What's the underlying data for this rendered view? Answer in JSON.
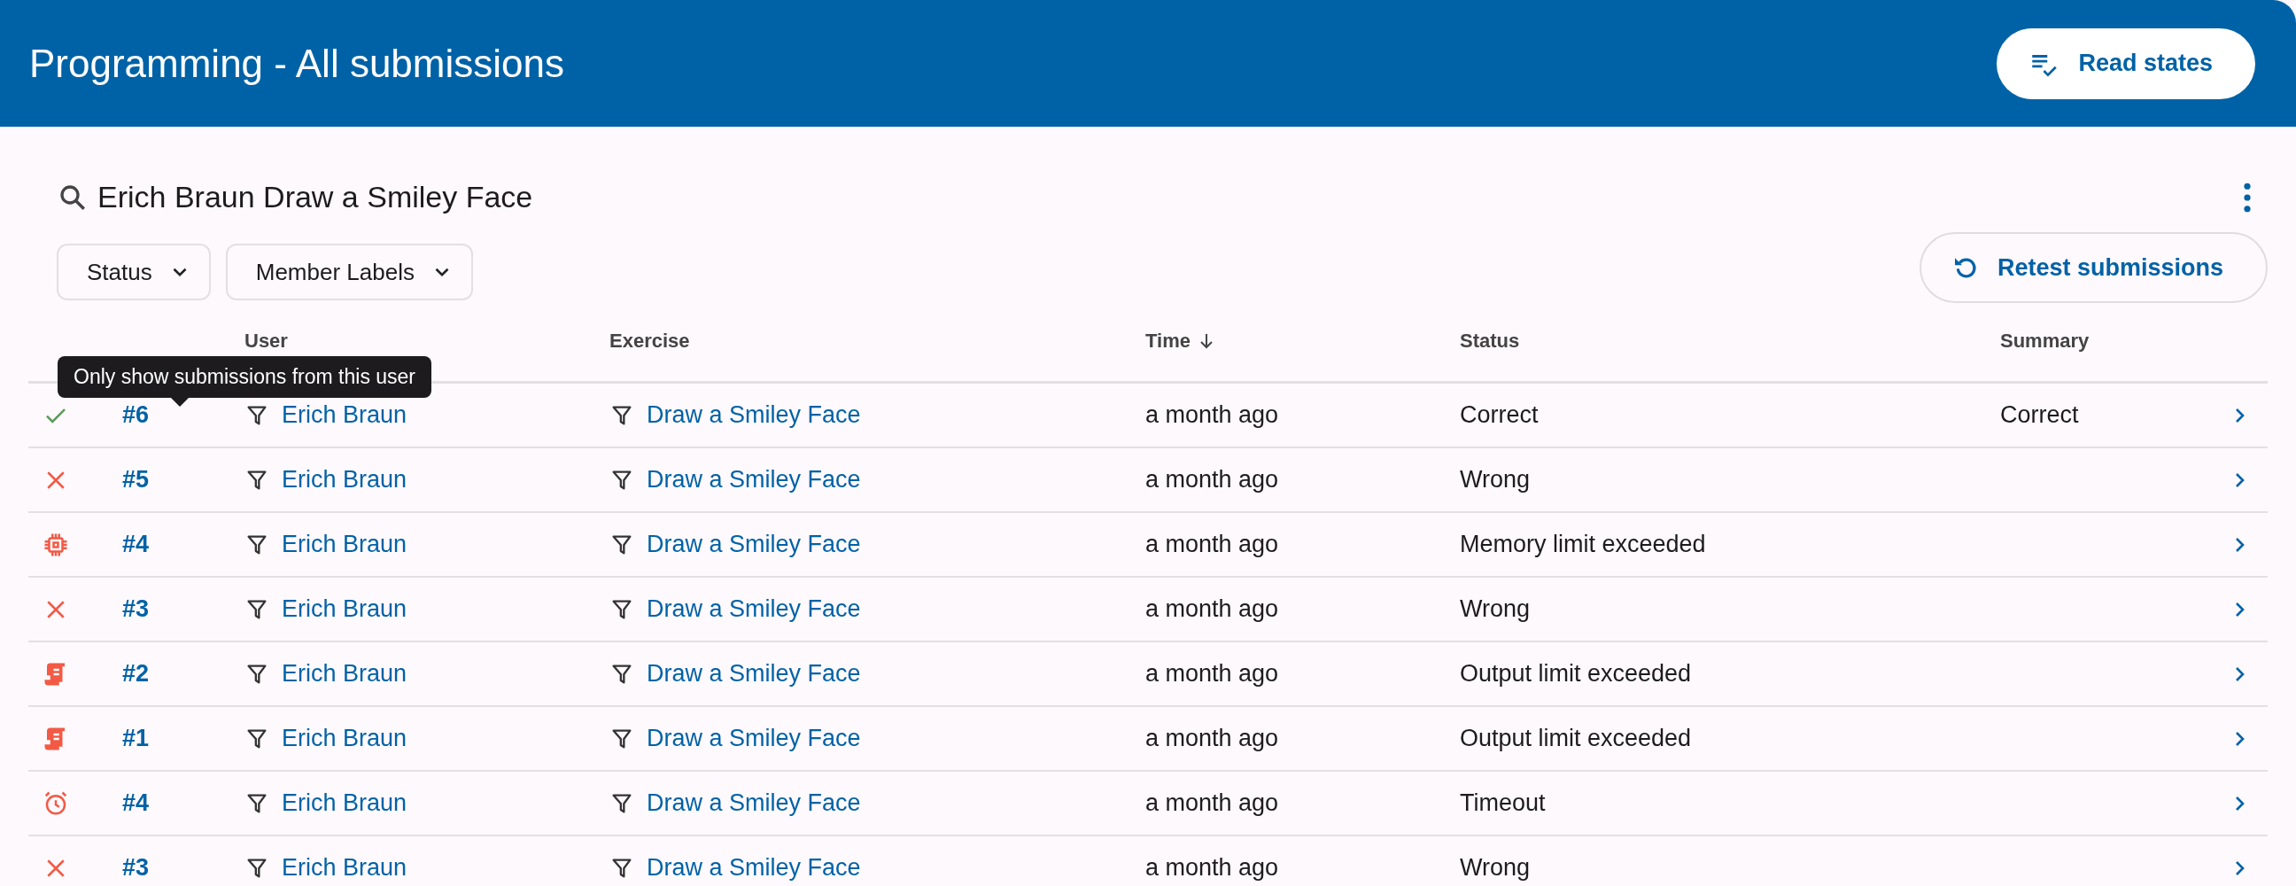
{
  "header": {
    "title": "Programming - All submissions",
    "action": "Read states"
  },
  "search": {
    "value": "Erich Braun Draw a Smiley Face"
  },
  "filters": [
    "Status",
    "Member Labels"
  ],
  "retest_button": "Retest submissions",
  "tooltip": "Only show submissions from this user",
  "table": {
    "columns": [
      {
        "label": "User"
      },
      {
        "label": "Exercise"
      },
      {
        "label": "Time",
        "sorted": true
      },
      {
        "label": "Status"
      },
      {
        "label": "Summary"
      }
    ],
    "rows": [
      {
        "kind": "correct",
        "id": "#6",
        "user": "Erich Braun",
        "exercise": "Draw a Smiley Face",
        "time": "a month ago",
        "status": "Correct",
        "summary": "Correct"
      },
      {
        "kind": "wrong",
        "id": "#5",
        "user": "Erich Braun",
        "exercise": "Draw a Smiley Face",
        "time": "a month ago",
        "status": "Wrong"
      },
      {
        "kind": "memory",
        "id": "#4",
        "user": "Erich Braun",
        "exercise": "Draw a Smiley Face",
        "time": "a month ago",
        "status": "Memory limit exceeded"
      },
      {
        "kind": "wrong",
        "id": "#3",
        "user": "Erich Braun",
        "exercise": "Draw a Smiley Face",
        "time": "a month ago",
        "status": "Wrong"
      },
      {
        "kind": "output",
        "id": "#2",
        "user": "Erich Braun",
        "exercise": "Draw a Smiley Face",
        "time": "a month ago",
        "status": "Output limit exceeded"
      },
      {
        "kind": "output",
        "id": "#1",
        "user": "Erich Braun",
        "exercise": "Draw a Smiley Face",
        "time": "a month ago",
        "status": "Output limit exceeded"
      },
      {
        "kind": "timeout",
        "id": "#4",
        "user": "Erich Braun",
        "exercise": "Draw a Smiley Face",
        "time": "a month ago",
        "status": "Timeout"
      },
      {
        "kind": "wrong",
        "id": "#3",
        "user": "Erich Braun",
        "exercise": "Draw a Smiley Face",
        "time": "a month ago",
        "status": "Wrong"
      }
    ]
  }
}
